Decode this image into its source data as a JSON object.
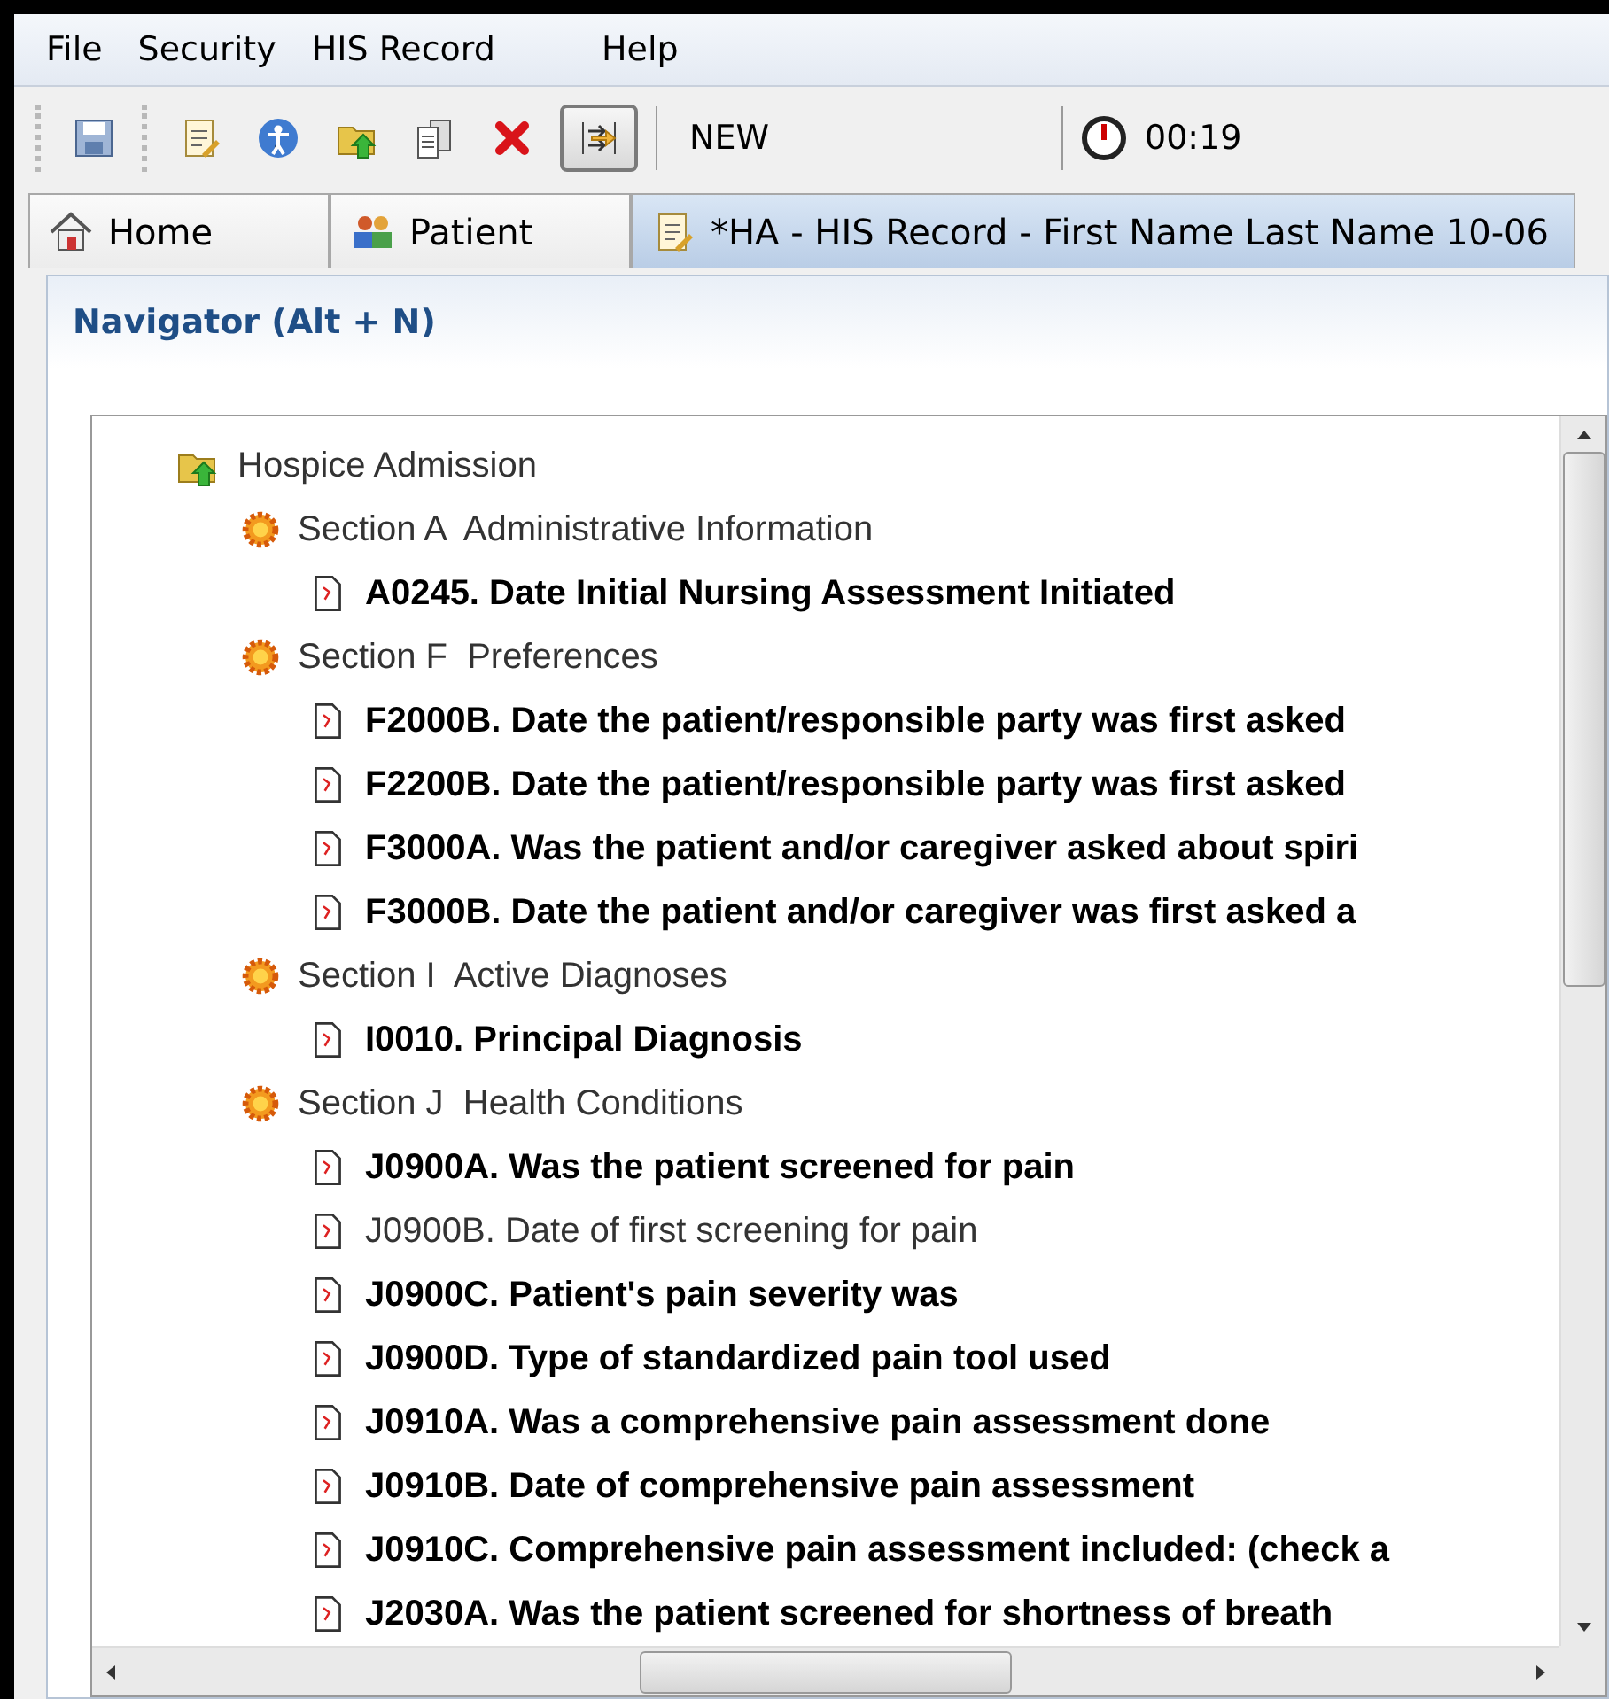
{
  "menu": [
    "File",
    "Security",
    "HIS Record",
    "Help"
  ],
  "toolbar": {
    "buttons": [
      {
        "kind": "save",
        "pressed": false
      },
      {
        "kind": "document",
        "pressed": false
      },
      {
        "kind": "person",
        "pressed": false
      },
      {
        "kind": "folder",
        "pressed": false
      },
      {
        "kind": "copy",
        "pressed": false
      },
      {
        "kind": "delete",
        "pressed": false
      },
      {
        "kind": "navigate",
        "pressed": true
      }
    ],
    "status": "NEW",
    "timer": "00:19"
  },
  "tabs": [
    {
      "label": "Home",
      "kind": "home",
      "selected": false
    },
    {
      "label": "Patient",
      "kind": "people",
      "selected": false
    },
    {
      "label": "*HA - HIS Record - First Name Last Name 10-06",
      "kind": "document",
      "selected": true
    }
  ],
  "navigator": {
    "title": "Navigator (Alt + N)",
    "tree": [
      {
        "label": "Hospice Admission",
        "kind": "root",
        "children": [
          {
            "label": "Section A  Administrative Information",
            "kind": "section",
            "children": [
              {
                "label": "A0245. Date Initial Nursing Assessment Initiated",
                "kind": "item",
                "emphasized": true
              }
            ]
          },
          {
            "label": "Section F  Preferences",
            "kind": "section",
            "children": [
              {
                "label": "F2000B. Date the patient/responsible party was first asked",
                "kind": "item",
                "emphasized": true
              },
              {
                "label": "F2200B. Date the patient/responsible party was first asked",
                "kind": "item",
                "emphasized": true
              },
              {
                "label": "F3000A. Was the patient and/or caregiver asked about spiri",
                "kind": "item",
                "emphasized": true
              },
              {
                "label": "F3000B. Date the patient and/or caregiver was first asked a",
                "kind": "item",
                "emphasized": true
              }
            ]
          },
          {
            "label": "Section I  Active Diagnoses",
            "kind": "section",
            "children": [
              {
                "label": "I0010. Principal Diagnosis",
                "kind": "item",
                "emphasized": true
              }
            ]
          },
          {
            "label": "Section J  Health Conditions",
            "kind": "section",
            "children": [
              {
                "label": "J0900A. Was the patient screened for pain",
                "kind": "item",
                "emphasized": true
              },
              {
                "label": "J0900B. Date of first screening for pain",
                "kind": "item",
                "emphasized": false
              },
              {
                "label": "J0900C. Patient's pain severity was",
                "kind": "item",
                "emphasized": true
              },
              {
                "label": "J0900D. Type of standardized pain tool used",
                "kind": "item",
                "emphasized": true
              },
              {
                "label": "J0910A. Was a comprehensive pain assessment done",
                "kind": "item",
                "emphasized": true
              },
              {
                "label": "J0910B. Date of comprehensive pain assessment",
                "kind": "item",
                "emphasized": true
              },
              {
                "label": "J0910C. Comprehensive pain assessment included: (check a",
                "kind": "item",
                "emphasized": true
              },
              {
                "label": "J2030A. Was the patient screened for shortness of breath",
                "kind": "item",
                "emphasized": true
              }
            ]
          }
        ]
      }
    ]
  }
}
